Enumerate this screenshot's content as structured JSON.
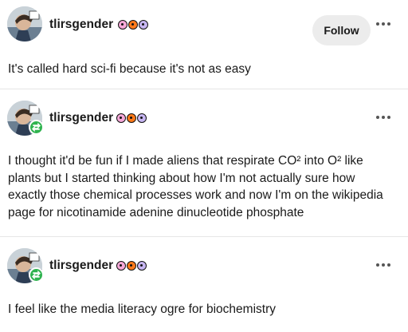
{
  "colors": {
    "follow_bg": "#ececec",
    "reblog_green": "#2fb34f",
    "text": "#1a1a1a"
  },
  "posts": [
    {
      "username": "tlirsgender",
      "follow_label": "Follow",
      "text": "It's called hard sci-fi because it's not as easy"
    },
    {
      "username": "tlirsgender",
      "reblog_icon": "reblog-icon",
      "text": "I thought it'd be fun if I made aliens that respirate CO² into O² like plants but I started thinking about how I'm not actually sure how exactly those chemical processes work and now I'm on the wikipedia page for nicotinamide adenine dinucleotide phosphate"
    },
    {
      "username": "tlirsgender",
      "reblog_icon": "reblog-icon",
      "text": "I feel like the media literacy ogre for biochemistry"
    }
  ]
}
